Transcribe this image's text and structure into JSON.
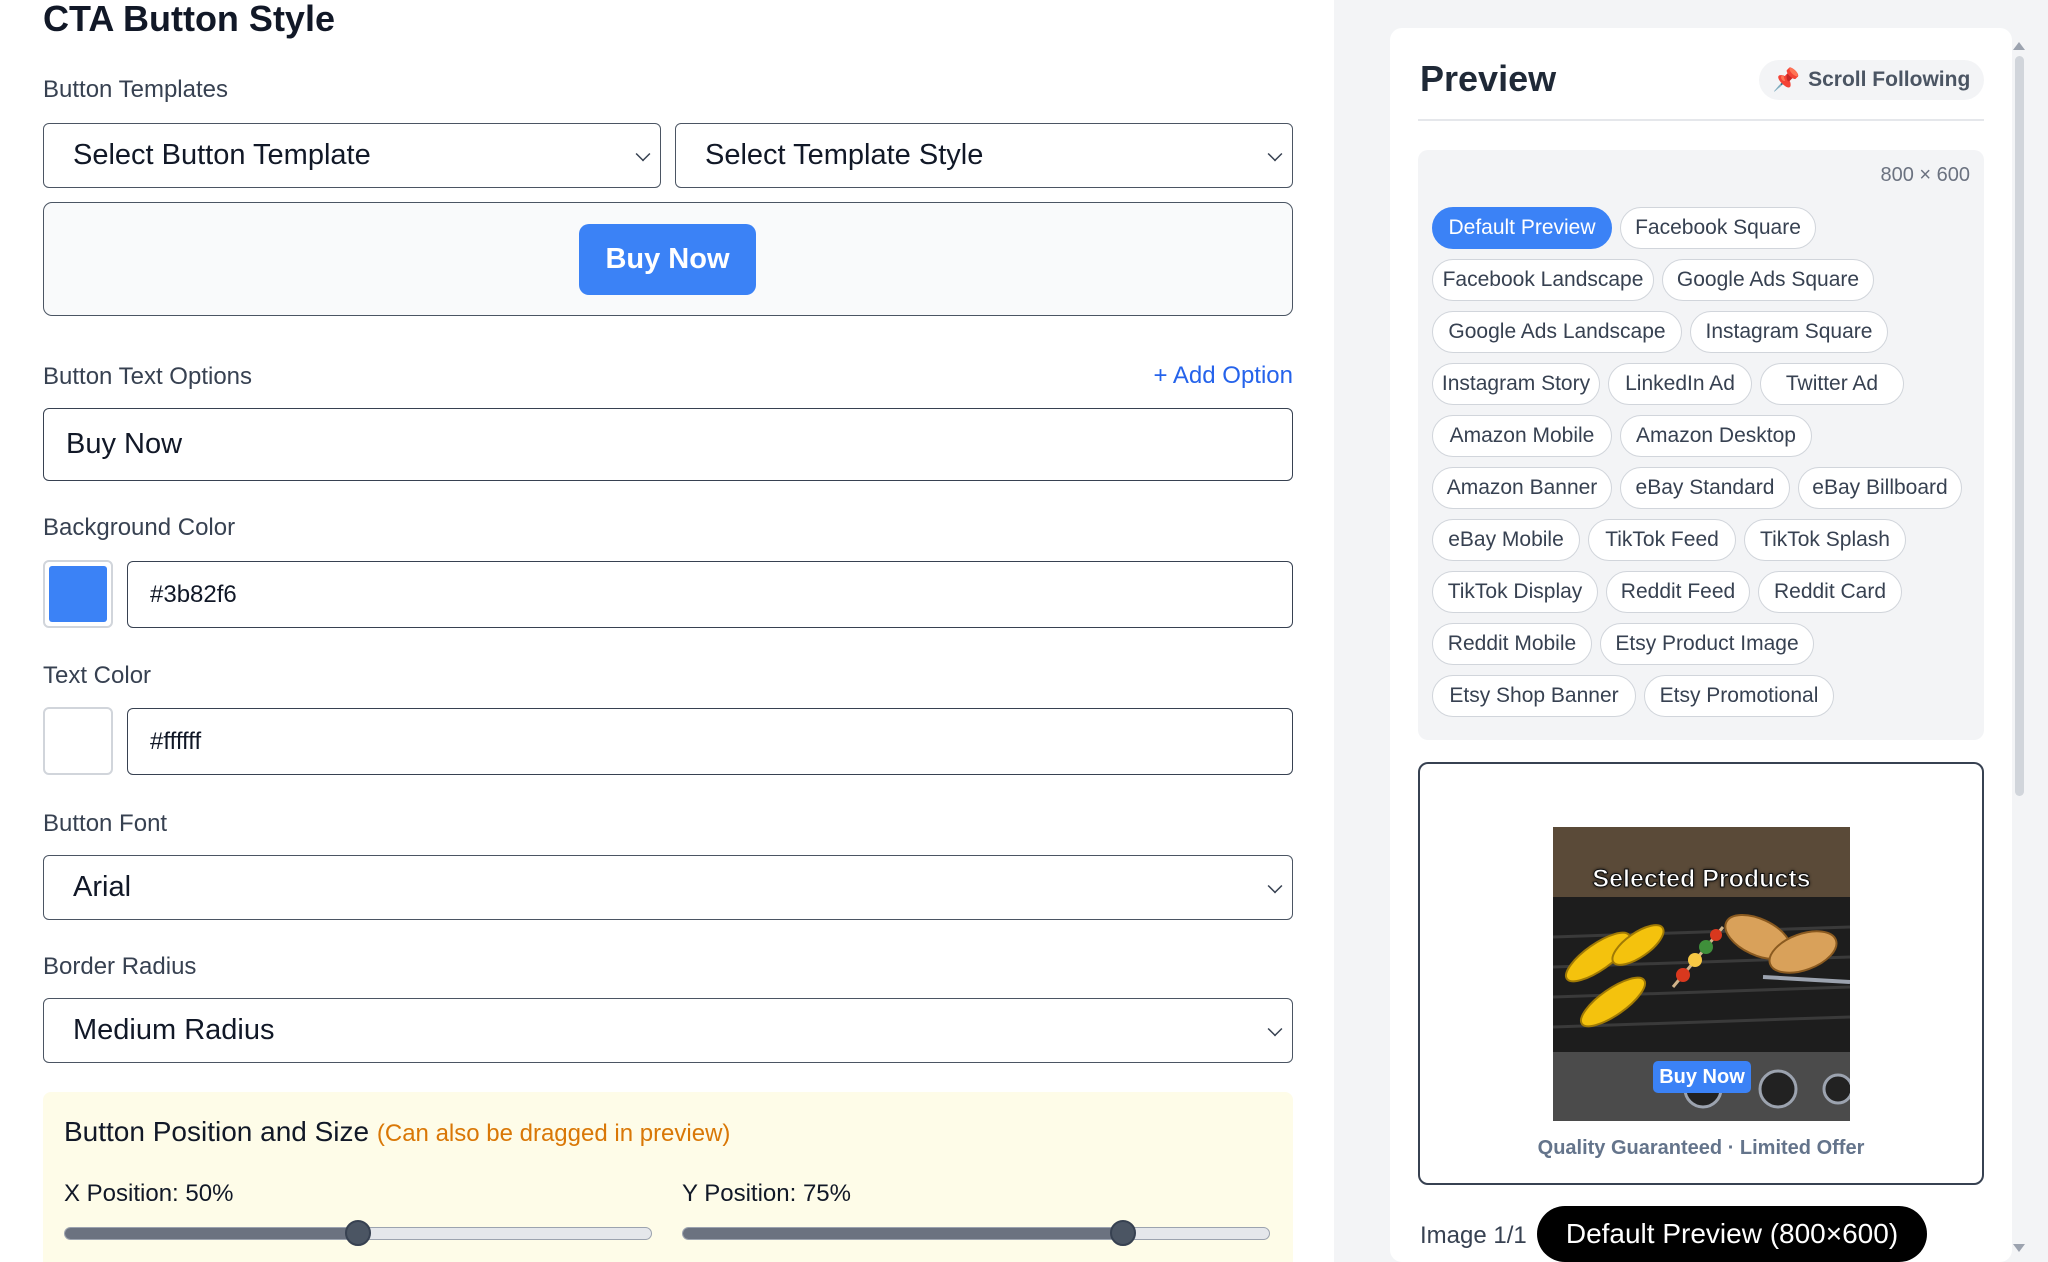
{
  "cta": {
    "title": "CTA Button Style",
    "templates_label": "Button Templates",
    "template_select": "Select Button Template",
    "style_select": "Select Template Style",
    "preview_button_text": "Buy Now",
    "text_options_label": "Button Text Options",
    "add_option": "+ Add Option",
    "text_option_value": "Buy Now",
    "bg_color_label": "Background Color",
    "bg_color_value": "#3b82f6",
    "text_color_label": "Text Color",
    "text_color_value": "#ffffff",
    "font_label": "Button Font",
    "font_value": "Arial",
    "radius_label": "Border Radius",
    "radius_value": "Medium Radius",
    "position_title": "Button Position and Size",
    "position_note": "(Can also be dragged in preview)",
    "x_label": "X Position: 50%",
    "y_label": "Y Position: 75%",
    "x_value": 50,
    "y_value": 75
  },
  "preview": {
    "title": "Preview",
    "scroll_following": "Scroll Following",
    "pin_icon": "pushpin-icon",
    "dims": "800 × 600",
    "presets": [
      "Default Preview",
      "Facebook Square",
      "Facebook Landscape",
      "Google Ads Square",
      "Google Ads Landscape",
      "Instagram Square",
      "Instagram Story",
      "LinkedIn Ad",
      "Twitter Ad",
      "Amazon Mobile",
      "Amazon Desktop",
      "Amazon Banner",
      "eBay Standard",
      "eBay Billboard",
      "eBay Mobile",
      "TikTok Feed",
      "TikTok Splash",
      "TikTok Display",
      "Reddit Feed",
      "Reddit Card",
      "Reddit Mobile",
      "Etsy Product Image",
      "Etsy Shop Banner",
      "Etsy Promotional"
    ],
    "active_preset": "Default Preview",
    "image_title": "Selected Products",
    "image_button": "Buy Now",
    "quality_text": "Quality Guaranteed · Limited Offer",
    "image_count": "Image 1/1",
    "image_pill": "Default Preview (800×600)"
  },
  "colors": {
    "accent": "#3b82f6",
    "note": "#d97706"
  }
}
